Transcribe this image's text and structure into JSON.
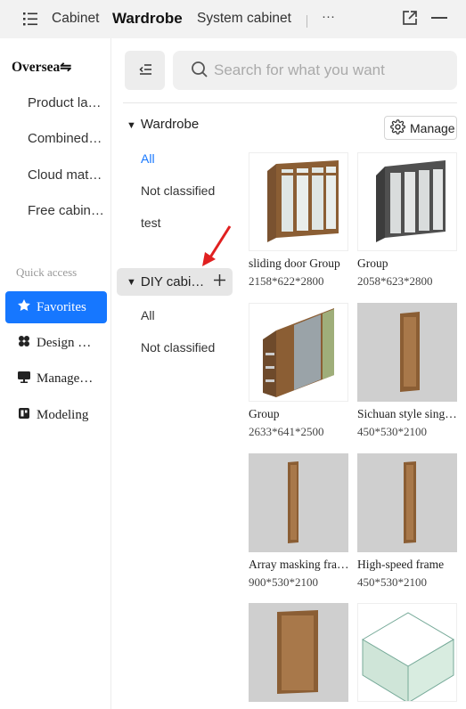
{
  "tabs": [
    "Cabinet",
    "Wardrobe",
    "System cabinet"
  ],
  "more_label": "···",
  "left": {
    "title": "Oversea",
    "items": [
      "Product la…",
      "Combined…",
      "Cloud mat…",
      "Free cabin…"
    ],
    "quick_access": "Quick access",
    "qa_items": [
      "Favorites",
      "Design …",
      "Manage…",
      "Modeling"
    ]
  },
  "search_placeholder": "Search for what you want",
  "wardrobe": {
    "title": "Wardrobe",
    "manage": "Manage",
    "subs": [
      "All",
      "Not classified",
      "test"
    ]
  },
  "diy": {
    "title": "DIY cabi…",
    "subs": [
      "All",
      "Not classified"
    ]
  },
  "cards": [
    {
      "name": "sliding door Group",
      "dims": "2158*622*2800"
    },
    {
      "name": "Group",
      "dims": "2058*623*2800"
    },
    {
      "name": "Group",
      "dims": "2633*641*2500"
    },
    {
      "name": "Sichuan style sing…",
      "dims": "450*530*2100"
    },
    {
      "name": "Array masking fra…",
      "dims": "900*530*2100"
    },
    {
      "name": "High-speed frame",
      "dims": "450*530*2100"
    },
    {
      "name": "",
      "dims": ""
    },
    {
      "name": "",
      "dims": ""
    }
  ],
  "colors": {
    "accent": "#1677ff",
    "selected_bg": "#1677ff",
    "annotation": "#e02020"
  }
}
